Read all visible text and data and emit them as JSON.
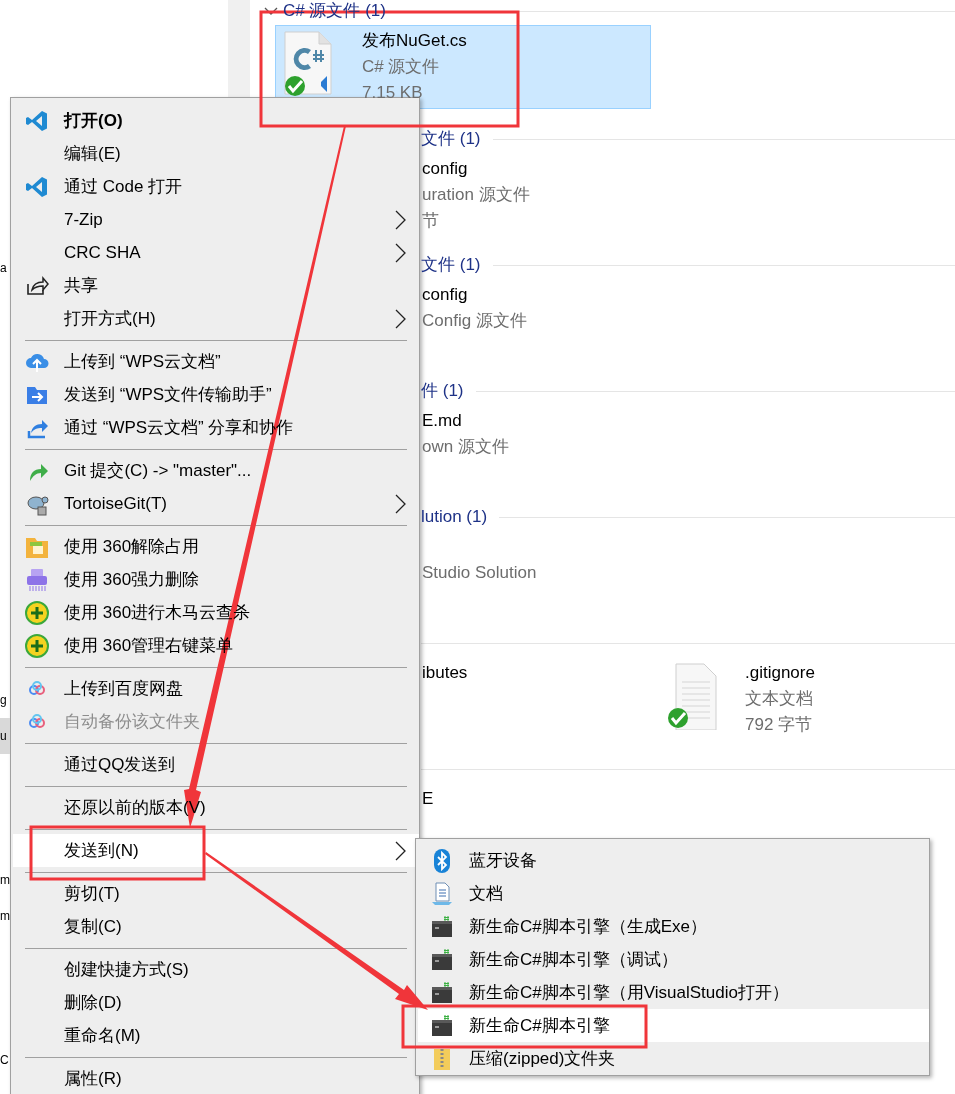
{
  "navigation_pane": {
    "fragments": [
      {
        "text": "a",
        "selected": false
      },
      {
        "text": "g",
        "selected": false
      },
      {
        "text": "u",
        "selected": true
      },
      {
        "text": "m",
        "selected": false
      },
      {
        "text": "m",
        "selected": false
      },
      {
        "text": "C",
        "selected": false
      }
    ]
  },
  "file_groups": [
    {
      "header": "C# 源文件 (1)",
      "items": [
        {
          "name": "发布NuGet.cs",
          "type": "C# 源文件",
          "size": "7.15 KB",
          "selected": true,
          "covered": false
        }
      ]
    },
    {
      "header": "文件 (1)",
      "items": [
        {
          "name": "config",
          "type": "uration 源文件",
          "size": "节",
          "selected": false,
          "covered": true
        }
      ]
    },
    {
      "header": "文件 (1)",
      "items": [
        {
          "name": "config",
          "type": "Config 源文件",
          "selected": false,
          "covered": true
        }
      ]
    },
    {
      "header": "件 (1)",
      "items": [
        {
          "name": "E.md",
          "type": "own 源文件",
          "selected": false,
          "covered": true
        }
      ]
    },
    {
      "header": "lution (1)",
      "items": [
        {
          "type": "Studio Solution",
          "selected": false,
          "covered": true
        }
      ]
    },
    {
      "items": [
        {
          "name": "ibutes",
          "selected": false,
          "covered": true
        },
        {
          "name": ".gitignore",
          "type": "文本文档",
          "size": "792 字节",
          "selected": false,
          "covered": false
        }
      ]
    },
    {
      "items": [
        {
          "name": "E",
          "selected": false,
          "covered": true
        }
      ]
    }
  ],
  "context_menu": {
    "items": [
      {
        "label": "打开(O)",
        "default": true,
        "submenu": false,
        "disabled": false,
        "selected": false
      },
      {
        "label": "编辑(E)",
        "default": false,
        "submenu": false,
        "disabled": false,
        "selected": false
      },
      {
        "label": "通过 Code 打开",
        "default": false,
        "submenu": false,
        "disabled": false,
        "selected": false
      },
      {
        "label": "7-Zip",
        "default": false,
        "submenu": true,
        "disabled": false,
        "selected": false
      },
      {
        "label": "CRC SHA",
        "default": false,
        "submenu": true,
        "disabled": false,
        "selected": false
      },
      {
        "label": "共享",
        "default": false,
        "submenu": false,
        "disabled": false,
        "selected": false
      },
      {
        "label": "打开方式(H)",
        "default": false,
        "submenu": true,
        "disabled": false,
        "selected": false
      },
      {
        "kind": "separator"
      },
      {
        "label": "上传到 “WPS云文档”",
        "default": false,
        "submenu": false,
        "disabled": false,
        "selected": false
      },
      {
        "label": "发送到 “WPS文件传输助手”",
        "default": false,
        "submenu": false,
        "disabled": false,
        "selected": false
      },
      {
        "label": "通过 “WPS云文档” 分享和协作",
        "default": false,
        "submenu": false,
        "disabled": false,
        "selected": false
      },
      {
        "kind": "separator"
      },
      {
        "label": "Git 提交(C) -> \"master\"...",
        "default": false,
        "submenu": false,
        "disabled": false,
        "selected": false
      },
      {
        "label": "TortoiseGit(T)",
        "default": false,
        "submenu": true,
        "disabled": false,
        "selected": false
      },
      {
        "kind": "separator"
      },
      {
        "label": "使用 360解除占用",
        "default": false,
        "submenu": false,
        "disabled": false,
        "selected": false
      },
      {
        "label": "使用 360强力删除",
        "default": false,
        "submenu": false,
        "disabled": false,
        "selected": false
      },
      {
        "label": "使用 360进行木马云查杀",
        "default": false,
        "submenu": false,
        "disabled": false,
        "selected": false
      },
      {
        "label": "使用 360管理右键菜单",
        "default": false,
        "submenu": false,
        "disabled": false,
        "selected": false
      },
      {
        "kind": "separator"
      },
      {
        "label": "上传到百度网盘",
        "default": false,
        "submenu": false,
        "disabled": false,
        "selected": false
      },
      {
        "label": "自动备份该文件夹",
        "default": false,
        "submenu": false,
        "disabled": true,
        "selected": false
      },
      {
        "kind": "separator"
      },
      {
        "label": "通过QQ发送到",
        "default": false,
        "submenu": false,
        "disabled": false,
        "selected": false
      },
      {
        "kind": "separator"
      },
      {
        "label": "还原以前的版本(V)",
        "default": false,
        "submenu": false,
        "disabled": false,
        "selected": false
      },
      {
        "kind": "separator"
      },
      {
        "label": "发送到(N)",
        "default": false,
        "submenu": true,
        "disabled": false,
        "selected": true
      },
      {
        "kind": "separator"
      },
      {
        "label": "剪切(T)",
        "default": false,
        "submenu": false,
        "disabled": false,
        "selected": false
      },
      {
        "label": "复制(C)",
        "default": false,
        "submenu": false,
        "disabled": false,
        "selected": false
      },
      {
        "kind": "separator"
      },
      {
        "label": "创建快捷方式(S)",
        "default": false,
        "submenu": false,
        "disabled": false,
        "selected": false
      },
      {
        "label": "删除(D)",
        "default": false,
        "submenu": false,
        "disabled": false,
        "selected": false
      },
      {
        "label": "重命名(M)",
        "default": false,
        "submenu": false,
        "disabled": false,
        "selected": false
      },
      {
        "kind": "separator"
      },
      {
        "label": "属性(R)",
        "default": false,
        "submenu": false,
        "disabled": false,
        "selected": false
      }
    ]
  },
  "send_to_menu": {
    "items": [
      {
        "label": "蓝牙设备",
        "selected": false
      },
      {
        "label": "文档",
        "selected": false
      },
      {
        "label": "新生命C#脚本引擎（生成Exe）",
        "selected": false
      },
      {
        "label": "新生命C#脚本引擎（调试）",
        "selected": false
      },
      {
        "label": "新生命C#脚本引擎（用VisualStudio打开）",
        "selected": false
      },
      {
        "label": "新生命C#脚本引擎",
        "selected": true
      },
      {
        "label": "压缩(zipped)文件夹",
        "selected": false
      }
    ]
  }
}
